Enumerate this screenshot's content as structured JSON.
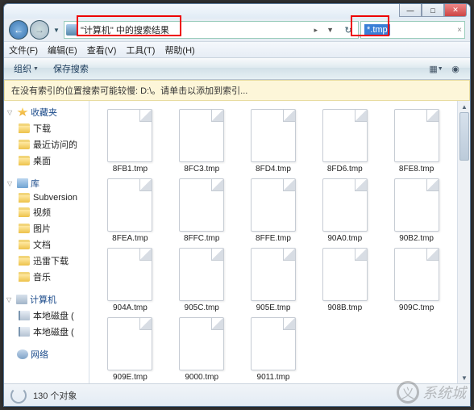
{
  "window": {
    "min": "—",
    "max": "□",
    "close": "✕"
  },
  "nav": {
    "back": "←",
    "fwd": "→",
    "drop": "▼",
    "refresh": "↻"
  },
  "address": {
    "text": "\"计算机\" 中的搜索结果",
    "arrow": "▸",
    "drop": "▼"
  },
  "search": {
    "value": "*.tmp",
    "clear": "×"
  },
  "menu": {
    "file": "文件(F)",
    "edit": "编辑(E)",
    "view": "查看(V)",
    "tools": "工具(T)",
    "help": "帮助(H)"
  },
  "toolbar": {
    "organize": "组织",
    "save_search": "保存搜索"
  },
  "info_strip": "在没有索引的位置搜索可能较慢: D:\\。请单击以添加到索引...",
  "sidebar": {
    "fav_head": "收藏夹",
    "fav": [
      {
        "label": "下载"
      },
      {
        "label": "最近访问的"
      },
      {
        "label": "桌面"
      }
    ],
    "lib_head": "库",
    "lib": [
      {
        "label": "Subversion"
      },
      {
        "label": "视频"
      },
      {
        "label": "图片"
      },
      {
        "label": "文档"
      },
      {
        "label": "迅雷下载"
      },
      {
        "label": "音乐"
      }
    ],
    "comp_head": "计算机",
    "comp": [
      {
        "label": "本地磁盘 ("
      },
      {
        "label": "本地磁盘 ("
      }
    ],
    "net_head": "网络"
  },
  "files": [
    "8FB1.tmp",
    "8FC3.tmp",
    "8FD4.tmp",
    "8FD6.tmp",
    "8FE8.tmp",
    "8FEA.tmp",
    "8FFC.tmp",
    "8FFE.tmp",
    "90A0.tmp",
    "90B2.tmp",
    "904A.tmp",
    "905C.tmp",
    "905E.tmp",
    "908B.tmp",
    "909C.tmp",
    "909E.tmp",
    "9000.tmp",
    "9011.tmp"
  ],
  "status": {
    "count": "130 个对象"
  },
  "watermark": "系统城"
}
